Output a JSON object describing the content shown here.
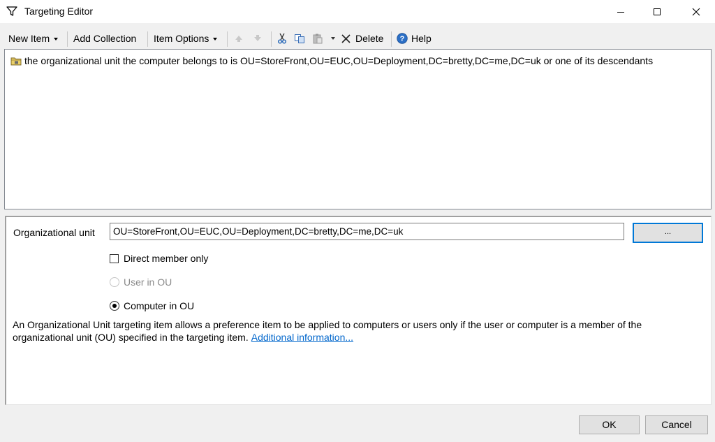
{
  "window": {
    "title": "Targeting Editor"
  },
  "toolbar": {
    "new_item": "New Item",
    "add_collection": "Add Collection",
    "item_options": "Item Options",
    "delete": "Delete",
    "help": "Help"
  },
  "tree": {
    "item_text": "the organizational unit the computer belongs to is OU=StoreFront,OU=EUC,OU=Deployment,DC=bretty,DC=me,DC=uk or one of its descendants"
  },
  "detail": {
    "ou_label": "Organizational unit",
    "ou_value": "OU=StoreFront,OU=EUC,OU=Deployment,DC=bretty,DC=me,DC=uk",
    "browse_label": "...",
    "direct_member_label": "Direct member only",
    "direct_member_checked": false,
    "user_in_ou_label": "User in OU",
    "computer_in_ou_label": "Computer in OU",
    "selected_option": "Computer in OU",
    "description": "An Organizational Unit targeting item allows a preference item to be applied to computers or users only if the user or computer is a member of the organizational unit (OU) specified in the targeting item.",
    "link_text": "Additional information..."
  },
  "footer": {
    "ok": "OK",
    "cancel": "Cancel"
  },
  "colors": {
    "focus_border": "#0078d7",
    "link": "#0066cc"
  }
}
